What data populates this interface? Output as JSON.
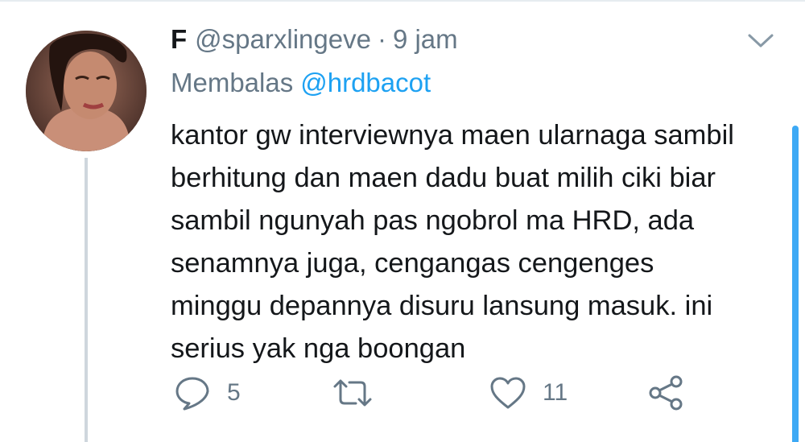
{
  "tweet": {
    "author_name": "F",
    "author_handle": "@sparxlingeve",
    "separator": "·",
    "time_ago": "9 jam",
    "reply_label": "Membalas",
    "reply_mention": "@hrdbacot",
    "text": "kantor gw interviewnya maen ularnaga sambil\nberhitung dan maen dadu buat milih ciki biar\nsambil ngunyah pas ngobrol ma HRD, ada\nsenamnya juga, cengangas cengenges\nminggu depannya disuru lansung masuk. ini\nserius yak nga boongan"
  },
  "actions": {
    "reply_count": "5",
    "retweet_count": "",
    "like_count": "11"
  },
  "icons": {
    "reply": "reply-icon",
    "retweet": "retweet-icon",
    "like": "heart-icon",
    "share": "share-icon",
    "menu": "chevron-down-icon"
  },
  "colors": {
    "text": "#14171a",
    "muted": "#657786",
    "link": "#1da1f2",
    "thread_line": "#cfd6dd",
    "scrollbar": "#3da9f5"
  }
}
